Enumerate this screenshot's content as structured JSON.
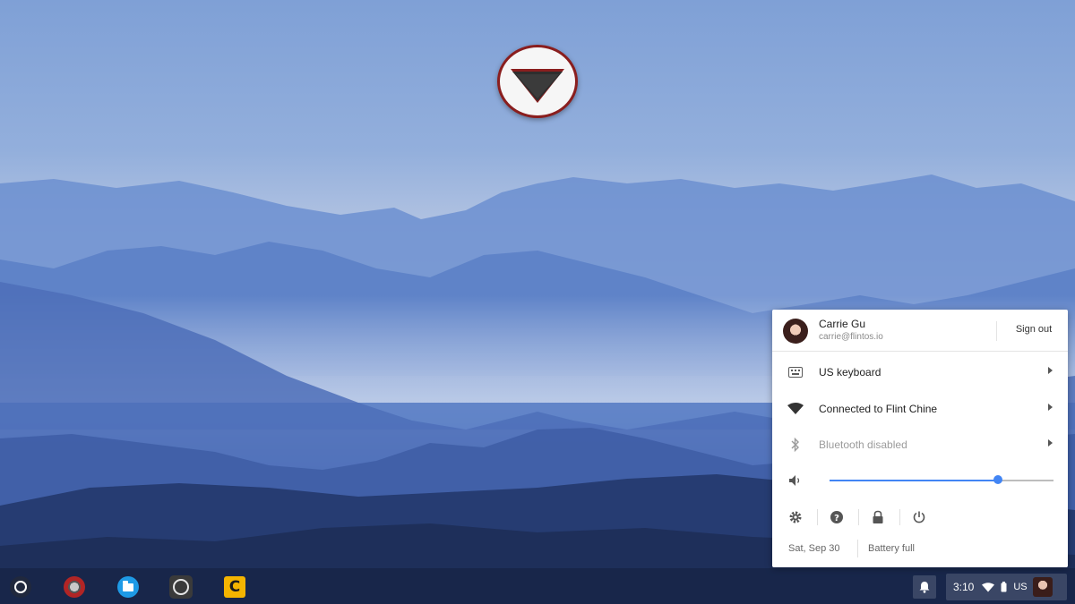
{
  "tray": {
    "user": {
      "name": "Carrie Gu",
      "email": "carrie@flintos.io",
      "sign_out": "Sign out"
    },
    "rows": [
      {
        "icon": "keyboard-icon",
        "label": "US keyboard",
        "disabled": false
      },
      {
        "icon": "wifi-icon",
        "label": "Connected to Flint Chine",
        "disabled": false
      },
      {
        "icon": "bluetooth-icon",
        "label": "Bluetooth disabled",
        "disabled": true
      }
    ],
    "volume": {
      "icon": "volume-icon",
      "level": 0.75
    },
    "actions": [
      "settings-icon",
      "help-icon",
      "lock-icon",
      "power-icon"
    ],
    "footer": {
      "date": "Sat, Sep 30",
      "battery": "Battery full"
    }
  },
  "shelf": {
    "apps": [
      "launcher-app-icon",
      "chrome-app-icon",
      "files-app-icon",
      "circle-app-icon",
      "c-app-icon"
    ],
    "c_app_letter": "C",
    "status": {
      "time": "3:10",
      "ime": "US"
    }
  },
  "colors": {
    "accent": "#4285f4",
    "logo_ring": "#8a1e1e",
    "c_app": "#f4b400",
    "files_app": "#1e9ae6"
  }
}
